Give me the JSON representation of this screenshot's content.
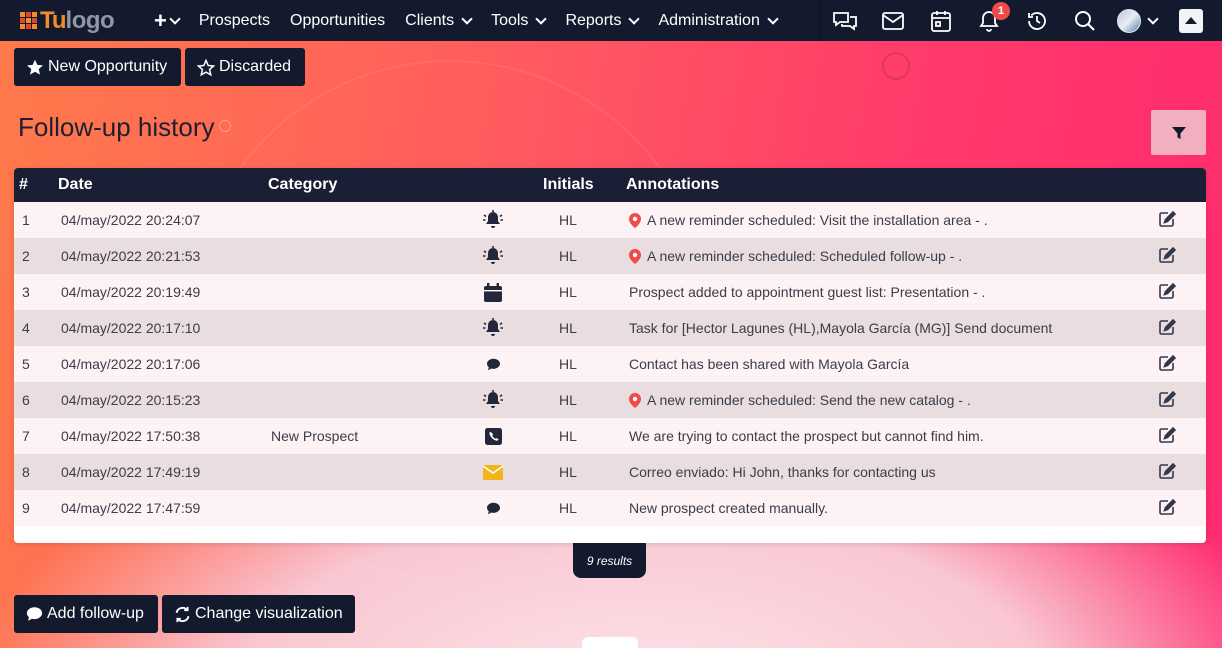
{
  "nav": {
    "logo_a": "Tu",
    "logo_b": "logo",
    "items": [
      {
        "label": "Prospects"
      },
      {
        "label": "Opportunities"
      },
      {
        "label": "Clients"
      },
      {
        "label": "Tools"
      },
      {
        "label": "Reports"
      },
      {
        "label": "Administration"
      }
    ],
    "notification_count": "1",
    "icons": [
      "chat-icon",
      "mail-icon",
      "calendar-icon",
      "bell-icon",
      "history-icon",
      "search-icon",
      "avatar",
      "scroll-up-icon"
    ]
  },
  "toolbar": {
    "new_opportunity": "New Opportunity",
    "discarded": "Discarded"
  },
  "page": {
    "title": "Follow-up history"
  },
  "table": {
    "headers": {
      "num": "#",
      "date": "Date",
      "category": "Category",
      "initials": "Initials",
      "annotations": "Annotations"
    },
    "rows": [
      {
        "num": "1",
        "date": "04/may/2022 20:24:07",
        "category": "",
        "icon": "bell-icon",
        "initials": "HL",
        "pin": true,
        "annotation": "A new reminder scheduled: Visit the installation area - ."
      },
      {
        "num": "2",
        "date": "04/may/2022 20:21:53",
        "category": "",
        "icon": "bell-icon",
        "initials": "HL",
        "pin": true,
        "annotation": "A new reminder scheduled: Scheduled follow-up - ."
      },
      {
        "num": "3",
        "date": "04/may/2022 20:19:49",
        "category": "",
        "icon": "calendar-icon",
        "initials": "HL",
        "pin": false,
        "annotation": "Prospect added to appointment guest list: Presentation - ."
      },
      {
        "num": "4",
        "date": "04/may/2022 20:17:10",
        "category": "",
        "icon": "bell-icon",
        "initials": "HL",
        "pin": false,
        "annotation": "Task for [Hector Lagunes (HL),Mayola García (MG)] Send document"
      },
      {
        "num": "5",
        "date": "04/may/2022 20:17:06",
        "category": "",
        "icon": "comment-icon",
        "initials": "HL",
        "pin": false,
        "annotation": "Contact has been shared with Mayola García"
      },
      {
        "num": "6",
        "date": "04/may/2022 20:15:23",
        "category": "",
        "icon": "bell-icon",
        "initials": "HL",
        "pin": true,
        "annotation": "A new reminder scheduled: Send the new catalog - ."
      },
      {
        "num": "7",
        "date": "04/may/2022 17:50:38",
        "category": "New Prospect",
        "icon": "phone-icon",
        "initials": "HL",
        "pin": false,
        "annotation": "We are trying to contact the prospect but cannot find him."
      },
      {
        "num": "8",
        "date": "04/may/2022 17:49:19",
        "category": "",
        "icon": "envelope-icon",
        "initials": "HL",
        "pin": false,
        "annotation": "Correo enviado: Hi John, thanks for contacting us"
      },
      {
        "num": "9",
        "date": "04/may/2022 17:47:59",
        "category": "",
        "icon": "comment-icon",
        "initials": "HL",
        "pin": false,
        "annotation": "New prospect created manually."
      }
    ],
    "results": "9 results"
  },
  "footer": {
    "add_followup": "Add follow-up",
    "change_visualization": "Change visualization"
  },
  "colors": {
    "navy": "#141a2e",
    "accent_orange": "#f28c28",
    "pin_red": "#ef4b4b",
    "envelope_yellow": "#f2b418"
  }
}
